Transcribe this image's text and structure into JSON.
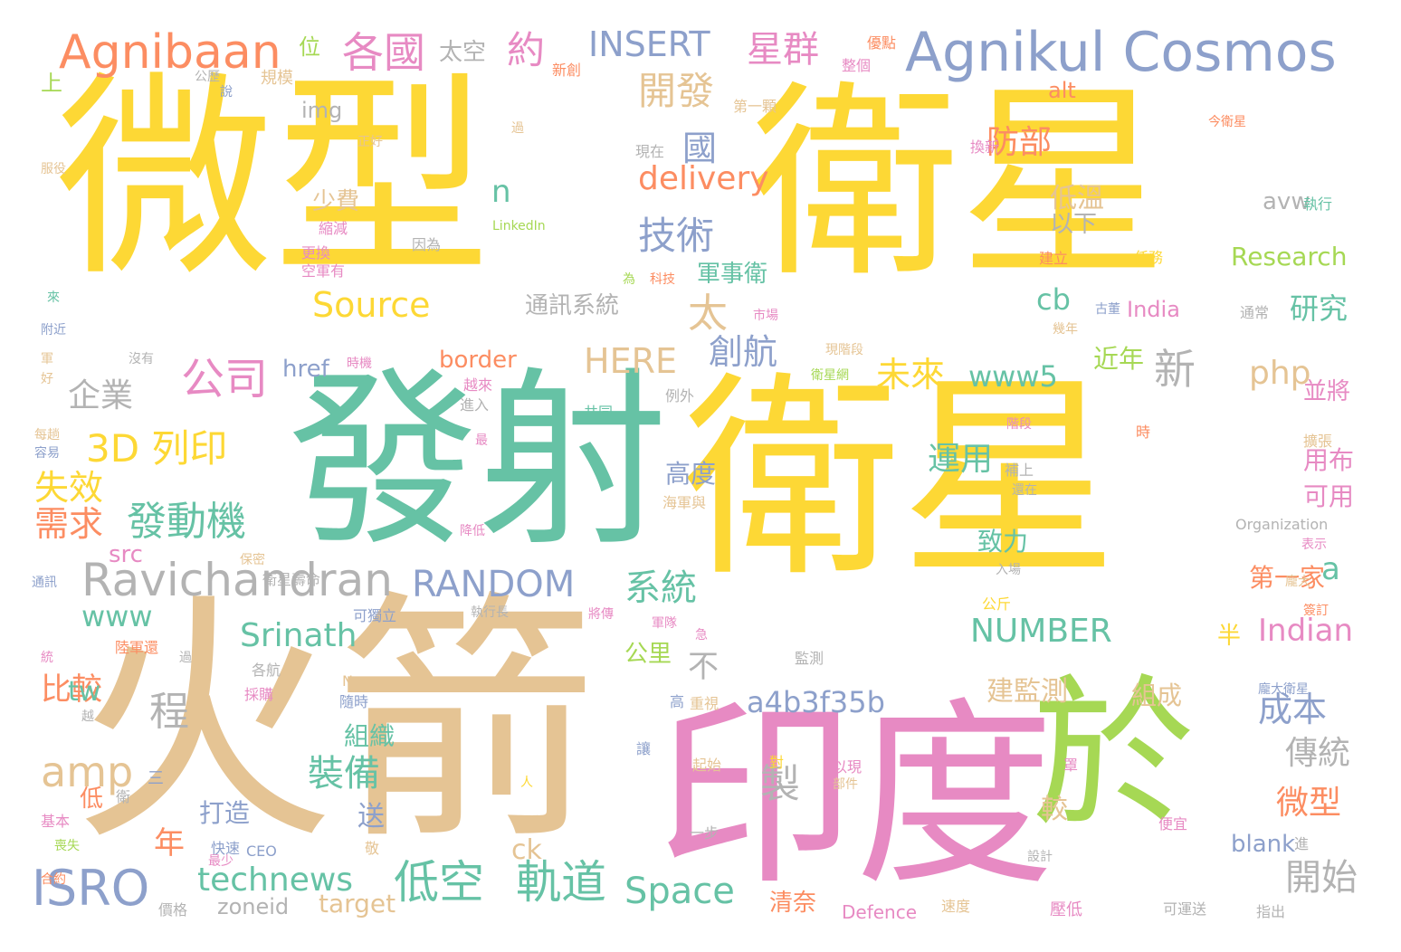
{
  "words": [
    {
      "text": "微型",
      "color": "#fdd835"
    },
    {
      "text": "衛星",
      "color": "#fdd835"
    },
    {
      "text": "衛星",
      "color": "#fdd835"
    },
    {
      "text": "發射",
      "color": "#66c2a5"
    },
    {
      "text": "火箭",
      "color": "#e5c494"
    },
    {
      "text": "印度",
      "color": "#e78ac3"
    },
    {
      "text": "於",
      "color": "#a6d854"
    },
    {
      "text": "Agnikul Cosmos",
      "color": "#8da0cb"
    },
    {
      "text": "Agnibaan",
      "color": "#fc8d62"
    },
    {
      "text": "Ravichandran",
      "color": "#b3b3b3"
    },
    {
      "text": "RANDOM",
      "color": "#8da0cb"
    },
    {
      "text": "ISRO",
      "color": "#8da0cb"
    },
    {
      "text": "technews",
      "color": "#66c2a5"
    },
    {
      "text": "低空",
      "color": "#66c2a5"
    },
    {
      "text": "軌道",
      "color": "#66c2a5"
    },
    {
      "text": "Space",
      "color": "#66c2a5"
    },
    {
      "text": "開始",
      "color": "#b3b3b3"
    },
    {
      "text": "3D 列印",
      "color": "#fdd835"
    },
    {
      "text": "發動機",
      "color": "#66c2a5"
    },
    {
      "text": "公司",
      "color": "#e78ac3"
    },
    {
      "text": "企業",
      "color": "#b3b3b3"
    },
    {
      "text": "各國",
      "color": "#e78ac3"
    },
    {
      "text": "約",
      "color": "#e78ac3"
    },
    {
      "text": "INSERT",
      "color": "#8da0cb"
    },
    {
      "text": "星群",
      "color": "#e78ac3"
    },
    {
      "text": "開發",
      "color": "#e5c494"
    },
    {
      "text": "技術",
      "color": "#8da0cb"
    },
    {
      "text": "delivery",
      "color": "#fc8d62"
    },
    {
      "text": "防部",
      "color": "#fc8d62"
    },
    {
      "text": "Source",
      "color": "#fdd835"
    },
    {
      "text": "HERE",
      "color": "#e5c494"
    },
    {
      "text": "創航",
      "color": "#8da0cb"
    },
    {
      "text": "未來",
      "color": "#fdd835"
    },
    {
      "text": "www5",
      "color": "#66c2a5"
    },
    {
      "text": "新",
      "color": "#b3b3b3"
    },
    {
      "text": "php",
      "color": "#e5c494"
    },
    {
      "text": "a4b3f35b",
      "color": "#8da0cb"
    },
    {
      "text": "NUMBER",
      "color": "#66c2a5"
    },
    {
      "text": "Indian",
      "color": "#e78ac3"
    },
    {
      "text": "Srinath",
      "color": "#66c2a5"
    },
    {
      "text": "www",
      "color": "#66c2a5"
    },
    {
      "text": "amp",
      "color": "#e5c494"
    },
    {
      "text": "裝備",
      "color": "#66c2a5"
    },
    {
      "text": "製",
      "color": "#b3b3b3"
    },
    {
      "text": "成本",
      "color": "#8da0cb"
    },
    {
      "text": "傳統",
      "color": "#b3b3b3"
    },
    {
      "text": "微型",
      "color": "#fc8d62"
    },
    {
      "text": "失效",
      "color": "#fdd835"
    },
    {
      "text": "需求",
      "color": "#fc8d62"
    },
    {
      "text": "比較",
      "color": "#fc8d62"
    },
    {
      "text": "程",
      "color": "#b3b3b3"
    },
    {
      "text": "系統",
      "color": "#66c2a5"
    },
    {
      "text": "運用",
      "color": "#66c2a5"
    },
    {
      "text": "太",
      "color": "#e5c494"
    },
    {
      "text": "年",
      "color": "#fc8d62"
    },
    {
      "text": "zoneid",
      "color": "#b3b3b3"
    },
    {
      "text": "target",
      "color": "#e5c494"
    },
    {
      "text": "清奈",
      "color": "#fc8d62"
    },
    {
      "text": "Defence",
      "color": "#e78ac3"
    },
    {
      "text": "Research",
      "color": "#a6d854"
    },
    {
      "text": "India",
      "color": "#e78ac3"
    },
    {
      "text": "研究",
      "color": "#66c2a5"
    },
    {
      "text": "cb",
      "color": "#66c2a5"
    },
    {
      "text": "通訊系統",
      "color": "#b3b3b3"
    },
    {
      "text": "軍事衛",
      "color": "#66c2a5"
    },
    {
      "text": "border",
      "color": "#fc8d62"
    },
    {
      "text": "href",
      "color": "#8da0cb"
    },
    {
      "text": "img",
      "color": "#b3b3b3"
    },
    {
      "text": "alt",
      "color": "#fc8d62"
    },
    {
      "text": "avw",
      "color": "#b3b3b3"
    },
    {
      "text": "blank",
      "color": "#8da0cb"
    },
    {
      "text": "ck",
      "color": "#e5c494"
    },
    {
      "text": "tw",
      "color": "#66c2a5"
    },
    {
      "text": "src",
      "color": "#e78ac3"
    },
    {
      "text": "n",
      "color": "#66c2a5"
    },
    {
      "text": "a",
      "color": "#66c2a5"
    },
    {
      "text": "國",
      "color": "#8da0cb"
    },
    {
      "text": "少費",
      "color": "#e5c494"
    },
    {
      "text": "以下",
      "color": "#b3b3b3"
    },
    {
      "text": "低溫",
      "color": "#e5c494"
    },
    {
      "text": "近年",
      "color": "#a6d854"
    },
    {
      "text": "並將",
      "color": "#e78ac3"
    },
    {
      "text": "用布",
      "color": "#e78ac3"
    },
    {
      "text": "可用",
      "color": "#e78ac3"
    },
    {
      "text": "第一家",
      "color": "#fc8d62"
    },
    {
      "text": "致力",
      "color": "#66c2a5"
    },
    {
      "text": "高度",
      "color": "#8da0cb"
    },
    {
      "text": "建監測",
      "color": "#e5c494"
    },
    {
      "text": "組成",
      "color": "#e5c494"
    },
    {
      "text": "公里",
      "color": "#a6d854"
    },
    {
      "text": "組織",
      "color": "#66c2a5"
    },
    {
      "text": "打造",
      "color": "#8da0cb"
    },
    {
      "text": "送",
      "color": "#8da0cb"
    },
    {
      "text": "較",
      "color": "#e5c494"
    },
    {
      "text": "不",
      "color": "#b3b3b3"
    },
    {
      "text": "低",
      "color": "#fc8d62"
    },
    {
      "text": "半",
      "color": "#fdd835"
    },
    {
      "text": "太空",
      "color": "#b3b3b3"
    },
    {
      "text": "位",
      "color": "#a6d854"
    },
    {
      "text": "上",
      "color": "#a6d854"
    },
    {
      "text": "規模",
      "color": "#e5c494"
    },
    {
      "text": "新創",
      "color": "#fc8d62"
    },
    {
      "text": "優點",
      "color": "#fc8d62"
    },
    {
      "text": "整個",
      "color": "#e78ac3"
    },
    {
      "text": "第一顆",
      "color": "#e5c494"
    },
    {
      "text": "今衛星",
      "color": "#fc8d62"
    },
    {
      "text": "換新",
      "color": "#e78ac3"
    },
    {
      "text": "執行",
      "color": "#66c2a5"
    },
    {
      "text": "建立",
      "color": "#fc8d62"
    },
    {
      "text": "任務",
      "color": "#fdd835"
    },
    {
      "text": "古董",
      "color": "#8da0cb"
    },
    {
      "text": "通常",
      "color": "#b3b3b3"
    },
    {
      "text": "幾年",
      "color": "#e5c494"
    },
    {
      "text": "現在",
      "color": "#b3b3b3"
    },
    {
      "text": "LinkedIn",
      "color": "#a6d854"
    },
    {
      "text": "因為",
      "color": "#b3b3b3"
    },
    {
      "text": "縮減",
      "color": "#e78ac3"
    },
    {
      "text": "更換",
      "color": "#e78ac3"
    },
    {
      "text": "空軍有",
      "color": "#e78ac3"
    },
    {
      "text": "為",
      "color": "#a6d854"
    },
    {
      "text": "科技",
      "color": "#fc8d62"
    },
    {
      "text": "市場",
      "color": "#e78ac3"
    },
    {
      "text": "現階段",
      "color": "#e5c494"
    },
    {
      "text": "衛星網",
      "color": "#a6d854"
    },
    {
      "text": "時機",
      "color": "#e78ac3"
    },
    {
      "text": "越來",
      "color": "#e78ac3"
    },
    {
      "text": "進入",
      "color": "#b3b3b3"
    },
    {
      "text": "共同",
      "color": "#66c2a5"
    },
    {
      "text": "例外",
      "color": "#b3b3b3"
    },
    {
      "text": "最",
      "color": "#e78ac3"
    },
    {
      "text": "階段",
      "color": "#e78ac3"
    },
    {
      "text": "時",
      "color": "#fc8d62"
    },
    {
      "text": "擴張",
      "color": "#e5c494"
    },
    {
      "text": "補上",
      "color": "#b3b3b3"
    },
    {
      "text": "還在",
      "color": "#b3b3b3"
    },
    {
      "text": "海軍與",
      "color": "#e5c494"
    },
    {
      "text": "降低",
      "color": "#e78ac3"
    },
    {
      "text": "Organization",
      "color": "#b3b3b3"
    },
    {
      "text": "表示",
      "color": "#e78ac3"
    },
    {
      "text": "入場",
      "color": "#b3b3b3"
    },
    {
      "text": "龐大",
      "color": "#e5c494"
    },
    {
      "text": "公斤",
      "color": "#fdd835"
    },
    {
      "text": "簽訂",
      "color": "#fc8d62"
    },
    {
      "text": "保密",
      "color": "#e5c494"
    },
    {
      "text": "衛星壽命",
      "color": "#b3b3b3"
    },
    {
      "text": "可獨立",
      "color": "#8da0cb"
    },
    {
      "text": "執行長",
      "color": "#b3b3b3"
    },
    {
      "text": "將傳",
      "color": "#e78ac3"
    },
    {
      "text": "軍隊",
      "color": "#e78ac3"
    },
    {
      "text": "急",
      "color": "#e78ac3"
    },
    {
      "text": "陸軍還",
      "color": "#fc8d62"
    },
    {
      "text": "過",
      "color": "#b3b3b3"
    },
    {
      "text": "監測",
      "color": "#b3b3b3"
    },
    {
      "text": "龐大衛星",
      "color": "#8da0cb"
    },
    {
      "text": "各航",
      "color": "#b3b3b3"
    },
    {
      "text": "News",
      "color": "#e5c494"
    },
    {
      "text": "採購",
      "color": "#e78ac3"
    },
    {
      "text": "隨時",
      "color": "#8da0cb"
    },
    {
      "text": "高",
      "color": "#8da0cb"
    },
    {
      "text": "重視",
      "color": "#e5c494"
    },
    {
      "text": "讓",
      "color": "#8da0cb"
    },
    {
      "text": "起始",
      "color": "#e5c494"
    },
    {
      "text": "對",
      "color": "#fdd835"
    },
    {
      "text": "以現",
      "color": "#e78ac3"
    },
    {
      "text": "部件",
      "color": "#e5c494"
    },
    {
      "text": "罩",
      "color": "#e78ac3"
    },
    {
      "text": "人",
      "color": "#fdd835"
    },
    {
      "text": "一步",
      "color": "#b3b3b3"
    },
    {
      "text": "便宜",
      "color": "#e78ac3"
    },
    {
      "text": "進",
      "color": "#b3b3b3"
    },
    {
      "text": "設計",
      "color": "#b3b3b3"
    },
    {
      "text": "可運送",
      "color": "#b3b3b3"
    },
    {
      "text": "壓低",
      "color": "#e78ac3"
    },
    {
      "text": "速度",
      "color": "#e5c494"
    },
    {
      "text": "指出",
      "color": "#b3b3b3"
    },
    {
      "text": "CEO",
      "color": "#8da0cb"
    },
    {
      "text": "快速",
      "color": "#8da0cb"
    },
    {
      "text": "最少",
      "color": "#e78ac3"
    },
    {
      "text": "敬",
      "color": "#e5c494"
    },
    {
      "text": "價格",
      "color": "#b3b3b3"
    },
    {
      "text": "三",
      "color": "#8da0cb"
    },
    {
      "text": "衛",
      "color": "#b3b3b3"
    },
    {
      "text": "越",
      "color": "#b3b3b3"
    },
    {
      "text": "基本",
      "color": "#e78ac3"
    },
    {
      "text": "喪失",
      "color": "#a6d854"
    },
    {
      "text": "合約",
      "color": "#fc8d62"
    },
    {
      "text": "統",
      "color": "#e78ac3"
    },
    {
      "text": "通訊",
      "color": "#8da0cb"
    },
    {
      "text": "容易",
      "color": "#8da0cb"
    },
    {
      "text": "每趟",
      "color": "#e5c494"
    },
    {
      "text": "好",
      "color": "#e5c494"
    },
    {
      "text": "軍",
      "color": "#e5c494"
    },
    {
      "text": "沒有",
      "color": "#b3b3b3"
    },
    {
      "text": "附近",
      "color": "#8da0cb"
    },
    {
      "text": "來",
      "color": "#66c2a5"
    },
    {
      "text": "服役",
      "color": "#e5c494"
    },
    {
      "text": "正好",
      "color": "#e5c494"
    },
    {
      "text": "公歷",
      "color": "#b3b3b3"
    },
    {
      "text": "說",
      "color": "#8da0cb"
    },
    {
      "text": "過",
      "color": "#e5c494"
    }
  ]
}
